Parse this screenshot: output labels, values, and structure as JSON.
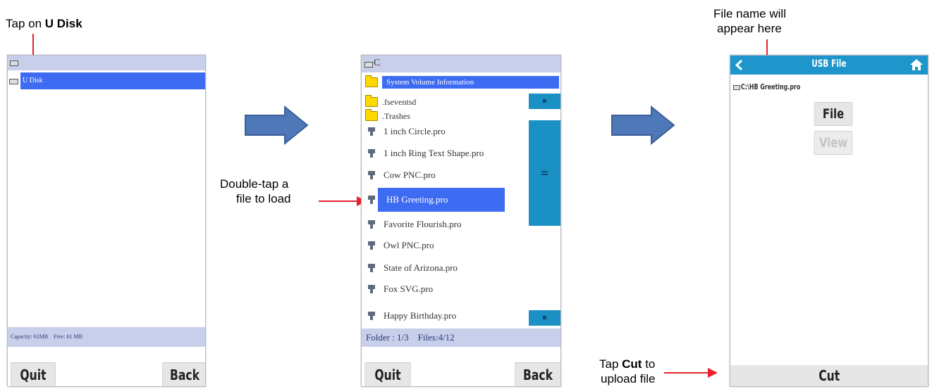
{
  "annotations": {
    "tap_udisk_prefix": "Tap on ",
    "tap_udisk_bold": "U Disk",
    "double_tap_line1": "Double-tap a",
    "double_tap_line2": "file to load",
    "file_name_line1": "File name will",
    "file_name_line2": "appear here",
    "tap_cut_prefix": "Tap ",
    "tap_cut_bold": "Cut",
    "tap_cut_suffix": " to",
    "tap_cut_line2": "upload file"
  },
  "screen1": {
    "drive_item": "U Disk",
    "status": "Capacity: 61MB    Free: 61 MB",
    "quit_label": "Quit",
    "back_label": "Back"
  },
  "screen2": {
    "path": "C",
    "items": [
      {
        "type": "folder",
        "name": "System Volume Information",
        "selected": true
      },
      {
        "type": "folder",
        "name": ".fseventsd",
        "selected": false
      },
      {
        "type": "folder",
        "name": ".Trashes",
        "selected": false
      },
      {
        "type": "file",
        "name": "1 inch Circle.pro",
        "selected": false
      },
      {
        "type": "file",
        "name": "1 inch Ring Text Shape.pro",
        "selected": false
      },
      {
        "type": "file",
        "name": "Cow PNC.pro",
        "selected": false
      },
      {
        "type": "file",
        "name": "HB Greeting.pro",
        "selected": true
      },
      {
        "type": "file",
        "name": "Favorite Flourish.pro",
        "selected": false
      },
      {
        "type": "file",
        "name": "Owl PNC.pro",
        "selected": false
      },
      {
        "type": "file",
        "name": "State of Arizona.pro",
        "selected": false
      },
      {
        "type": "file",
        "name": "Fox SVG.pro",
        "selected": false
      },
      {
        "type": "file",
        "name": "Happy Birthday.pro",
        "selected": false
      }
    ],
    "status": "Folder : 1/3    Files:4/12",
    "quit_label": "Quit",
    "back_label": "Back"
  },
  "screen3": {
    "title": "USB File",
    "file_path": "C:\\HB Greeting.pro",
    "file_label": "File",
    "view_label": "View",
    "cut_label": "Cut"
  },
  "colors": {
    "header_blue": "#1e96cc",
    "selection_blue": "#3d6bf2",
    "status_bar": "#c7cfea",
    "annotation_red": "#e8212b",
    "arrow_blue": "#4f78b8"
  }
}
